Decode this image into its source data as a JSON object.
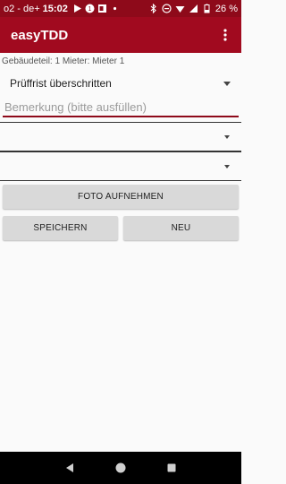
{
  "status_bar": {
    "carrier": "o2 - de+",
    "time": "15:02",
    "battery": "26 %",
    "left_icons": [
      "play-icon",
      "notification-icon",
      "outlook-icon",
      "dot-icon"
    ],
    "right_icons": [
      "bluetooth-icon",
      "do-not-disturb-icon",
      "wifi-icon",
      "signal-icon",
      "battery-icon"
    ]
  },
  "app_bar": {
    "title": "easyTDD",
    "menu_icon": "overflow-menu-icon"
  },
  "form": {
    "info_line": "Gebäudeteil: 1 Mieter: Mieter 1",
    "status_spinner": "Prüffrist überschritten",
    "remark_placeholder": "Bemerkung (bitte ausfüllen)",
    "remark_value": "",
    "spinner_2": "",
    "spinner_3": ""
  },
  "buttons": {
    "photo": "FOTO AUFNEHMEN",
    "save": "SPEICHERN",
    "new": "NEU"
  },
  "colors": {
    "status_bar": "#8e0a1a",
    "app_bar": "#a10a1f",
    "accent_underline": "#8e0a1a",
    "button_bg": "#d9d9d9",
    "background": "#fafafa"
  }
}
